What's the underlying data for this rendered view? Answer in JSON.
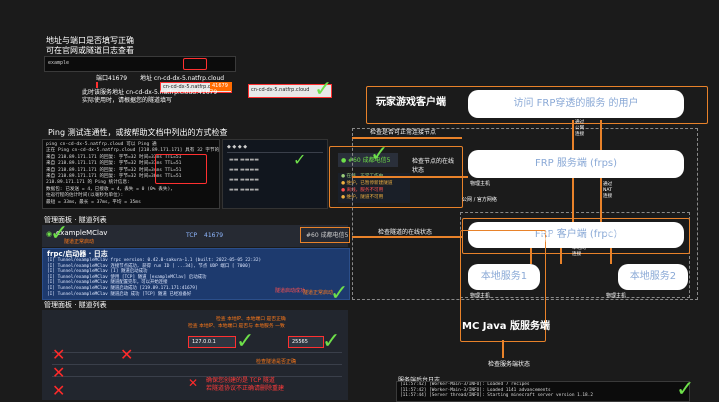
{
  "top_left": {
    "caption1": "地址与端口是否填写正确",
    "caption2": "可在官网或隧道日志查看",
    "terminal_text": "example",
    "port_label": "端口41679",
    "address_label": "地址 cn-cd-dx-5.natfrp.cloud",
    "addr_field": "cn-cd-dx-5.natfrp.cloud",
    "port_field": "41679",
    "note1": "此时该服务地址 cn-cd-dx-5.natfrp.cloud:41679",
    "note2": "实际使用时，请根据您的隧道填写"
  },
  "ping": {
    "title": "Ping 测试连通性，或按帮助文档中列出的方式检查",
    "lines": [
      "ping cn-cd-dx-5.natfrp.cloud 可以 Ping 通",
      "正在 Ping cn-cd-dx-5.natfrp.cloud [218.89.171.171] 具有 32 字节的数据:",
      "来自 218.89.171.171 的回复: 字节=32 时间=33ms TTL=51",
      "来自 218.89.171.171 的回复: 字节=32 时间=37ms TTL=51",
      "来自 218.89.171.171 的回复: 字节=32 时间=34ms TTL=51",
      "来自 218.89.171.171 的回复: 字节=32 时间=36ms TTL=51",
      "218.89.171.171 的 Ping 统计信息:",
      "    数据包: 已发送 = 4，已接收 = 4，丢失 = 0 (0% 丢失)，",
      "往返行程的估计时间(以毫秒为单位):",
      "    最短 = 33ms，最长 = 37ms，平均 = 35ms"
    ]
  },
  "node_status": {
    "node_name": "#60 成都电信5",
    "title_tag": "检查节点的在线状态",
    "items": [
      "在线，正常工作中",
      "维护，已暂停新建隧道",
      "离线，服务不可用",
      "维护，隧道不可用"
    ]
  },
  "tunnel_panel": {
    "title": "管理面板 · 隧道列表",
    "tunnel_name": "exampleMClav",
    "tunnel_tag": "隧道正常启动",
    "protocol": "TCP",
    "port": "41679",
    "node": "#60 成都电信5",
    "log_title": "frpc/启动器 · 日志",
    "log_lines": [
      "[I] Tunnel/exampleMClav frpc version: 0.42.0-sakura-1.1 (built: 2022-05-05 22:32)",
      "[I] Tunnel/exampleMClav 连接节点成功, 获得 run ID [ ...34], 节点 UDP 端口 [ 7000]",
      "[I] Tunnel/exampleMClav [I] 隧道启动成功",
      "[I] Tunnel/exampleMClav 使用 [TCP] 隧道 [exampleMClav] 启动成功",
      "[I] Tunnel/exampleMClav 隧道配置完毕，可以开始连接",
      "[I] Tunnel/exampleMClav 隧道启动成功 [219.89.171.171:41679]",
      "[I] Tunnel/exampleMClav 隧道启动 成功 [TCP] 隧道 已经准备好"
    ],
    "log_tag1": "隧道启动成功",
    "log_tag2": "隧道正常启动"
  },
  "bottom_panel": {
    "title": "管理面板 · 隧道列表",
    "tag_top": "检查 本地IP、本地端口 是否与 本地服务 一致",
    "tag_top2": "检查 本地IP、本地端口 是否正确",
    "field1": "127.0.0.1",
    "field2": "25565",
    "warn1": "确保您创建的是 TCP 隧道",
    "warn2": "若隧道协议不正确请删除重建",
    "tag_proto": "检查隧道是否正确",
    "bottom_label": "服务端后台日志",
    "console_lines": [
      "[11:57:42] [Worker-Main-3/INFO]: Loaded 7 recipes",
      "[11:57:42] [Worker-Main-3/INFO]: Loaded 1141 advancements",
      "[11:57:44] [Server thread/INFO]: Starting minecraft server version 1.18.2"
    ]
  },
  "diagram": {
    "player_label": "玩家游戏客户端",
    "player_node": "访问 FRP穿透的服务 的用户",
    "frps_node": "FRP 服务端 (frps)",
    "frpc_node": "FRP 客户端 (frpc)",
    "local1": "本地服务1",
    "local2": "本地服务2",
    "host1": "物理主机",
    "host2": "物理主机",
    "host3": "物理主机",
    "cloud_label": "公网 / 官方网络",
    "mc_label": "MC Java 版服务端",
    "check_node_text": "检查是否可正常连接节点",
    "check_tunnel_text": "检查隧道的在线状态",
    "check_service_text": "检查服务端状态",
    "arrow_texts": [
      "通过\n公网\n连接",
      "通过\nNAT\n连接",
      "通过\n本地网\n连接",
      "通过\n本地网\n连接",
      "通过\n局域网\n连接"
    ]
  },
  "colors": {
    "accent": "#e8822a",
    "check": "#6ee04a",
    "danger": "#ff2a2a",
    "link": "#5cc8ff"
  }
}
